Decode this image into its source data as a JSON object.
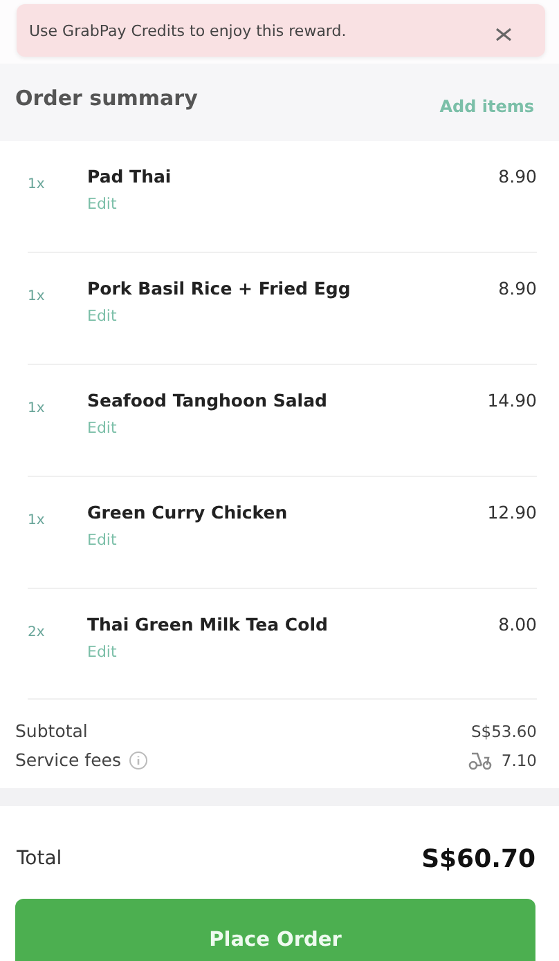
{
  "toast": {
    "message": "Use GrabPay Credits to enjoy this reward."
  },
  "order_summary": {
    "title": "Order summary",
    "add_items": "Add items",
    "items": [
      {
        "quantity": "1x",
        "name": "Pad Thai",
        "edit": "Edit",
        "price": "8.90"
      },
      {
        "quantity": "1x",
        "name": "Pork Basil Rice + Fried Egg",
        "edit": "Edit",
        "price": "8.90"
      },
      {
        "quantity": "1x",
        "name": "Seafood Tanghoon Salad",
        "edit": "Edit",
        "price": "14.90"
      },
      {
        "quantity": "1x",
        "name": "Green Curry Chicken",
        "edit": "Edit",
        "price": "12.90"
      },
      {
        "quantity": "2x",
        "name": "Thai Green Milk Tea Cold",
        "edit": "Edit",
        "price": "8.00"
      }
    ]
  },
  "fees": [
    {
      "kind": "plain",
      "label": "Subtotal",
      "value": "S$53.60"
    },
    {
      "kind": "delivery",
      "label": "Service fees",
      "value": "7.10"
    }
  ],
  "total": {
    "label": "Total",
    "value": "S$60.70"
  },
  "button": {
    "label": "Place Order"
  }
}
